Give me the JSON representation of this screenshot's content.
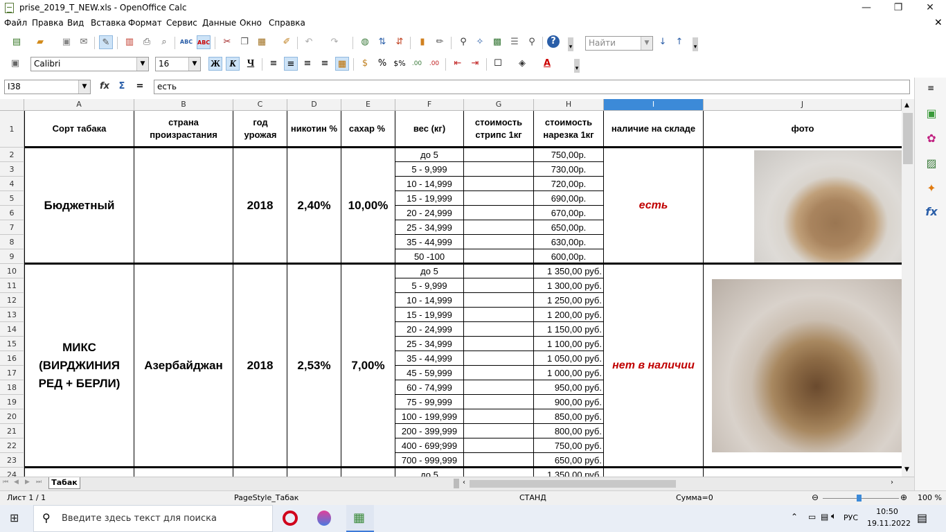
{
  "window": {
    "title": "prise_2019_T_NEW.xls - OpenOffice Calc",
    "minimize": "—",
    "maximize": "❐",
    "close": "✕"
  },
  "menu": [
    "Файл",
    "Правка",
    "Вид",
    "Вставка",
    "Формат",
    "Сервис",
    "Данные",
    "Окно",
    "Справка"
  ],
  "toolbar": {
    "find_placeholder": "Найти",
    "font_name": "Calibri",
    "font_size": "16",
    "bold": "Ж",
    "italic": "К",
    "underline": "Ч"
  },
  "formula": {
    "cell_ref": "I38",
    "content": "есть"
  },
  "columns": [
    "A",
    "B",
    "C",
    "D",
    "E",
    "F",
    "G",
    "H",
    "I",
    "J"
  ],
  "selected_column": "I",
  "header_row": {
    "A": "Сорт табака",
    "B": "страна произрастания",
    "C": "год урожая",
    "D": "никотин %",
    "E": "сахар %",
    "F": "вес (кг)",
    "G": "стоимость стрипс 1кг",
    "H": "стоимость нарезка 1кг",
    "I": "наличие на складе",
    "J": "фото"
  },
  "rows": [
    "1",
    "2",
    "3",
    "4",
    "5",
    "6",
    "7",
    "8",
    "9",
    "10",
    "11",
    "12",
    "13",
    "14",
    "15",
    "16",
    "17",
    "18",
    "19",
    "20",
    "21",
    "22",
    "23",
    "24"
  ],
  "group1": {
    "name": "Бюджетный",
    "country": "",
    "year": "2018",
    "nicotine": "2,40%",
    "sugar": "10,00%",
    "stock": "есть",
    "weights": [
      "до 5",
      "5 - 9,999",
      "10 - 14,999",
      "15 - 19,999",
      "20 - 24,999",
      "25 - 34,999",
      "35 - 44,999",
      "50 -100"
    ],
    "prices": [
      "750,00р.",
      "730,00р.",
      "720,00р.",
      "690,00р.",
      "670,00р.",
      "650,00р.",
      "630,00р.",
      "600,00р."
    ]
  },
  "group2": {
    "name": "МИКС (ВИРДЖИНИЯ РЕД + БЕРЛИ)",
    "country": "Азербайджан",
    "year": "2018",
    "nicotine": "2,53%",
    "sugar": "7,00%",
    "stock": "нет в наличии",
    "weights": [
      "до 5",
      "5 - 9,999",
      "10 - 14,999",
      "15 - 19,999",
      "20 - 24,999",
      "25 - 34,999",
      "35 - 44,999",
      "45 - 59,999",
      "60 - 74,999",
      "75 - 99,999",
      "100 - 199,999",
      "200 - 399,999",
      "400 - 699;999",
      "700 - 999,999"
    ],
    "prices": [
      "1 350,00 руб.",
      "1 300,00 руб.",
      "1 250,00 руб.",
      "1 200,00 руб.",
      "1 150,00 руб.",
      "1 100,00 руб.",
      "1 050,00 руб.",
      "1 000,00 руб.",
      "950,00 руб.",
      "900,00 руб.",
      "850,00 руб.",
      "800,00 руб.",
      "750,00 руб.",
      "650,00 руб."
    ]
  },
  "row24": {
    "weight": "до 5",
    "price": "1 350,00 руб."
  },
  "sheet_tab": "Табак",
  "status": {
    "sheet": "Лист 1 / 1",
    "page_style": "PageStyle_Табак",
    "mode": "СТАНД",
    "sum": "Сумма=0",
    "zoom": "100 %"
  },
  "taskbar": {
    "search_placeholder": "Введите здесь текст для поиска",
    "lang": "РУС",
    "time": "10:50",
    "date": "19.11.2022"
  }
}
